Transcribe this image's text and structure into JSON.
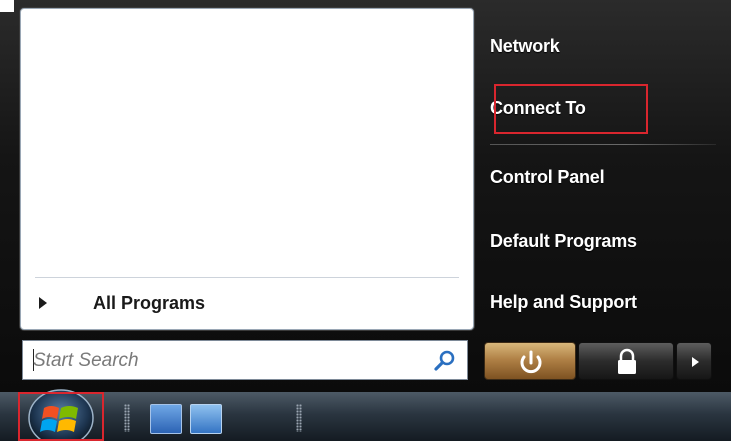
{
  "right_links": {
    "network": "Network",
    "connect_to": "Connect To",
    "control_panel": "Control Panel",
    "default_programs": "Default Programs",
    "help_and_support": "Help and Support"
  },
  "left_pane": {
    "all_programs": "All Programs"
  },
  "search": {
    "placeholder": "Start Search"
  },
  "icons": {
    "search": "magnifier-icon",
    "power": "power-icon",
    "lock": "lock-icon",
    "more": "arrow-right-icon",
    "start": "windows-logo-icon",
    "show_desktop": "show-desktop-icon",
    "switch_windows": "switch-windows-icon"
  },
  "colors": {
    "highlight": "#d9262e",
    "power_button": "#b08146"
  }
}
